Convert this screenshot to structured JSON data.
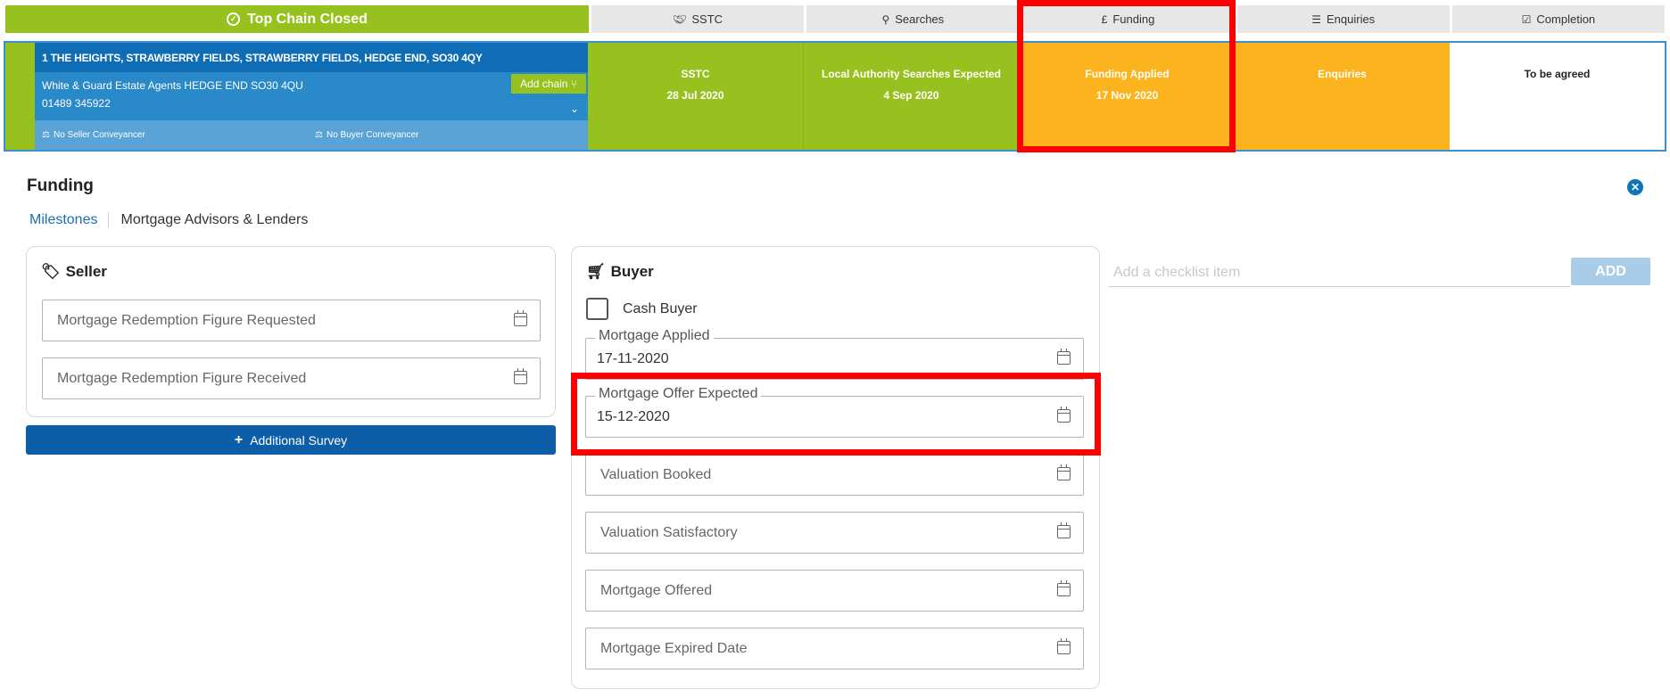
{
  "stages": {
    "chain_label": "Top Chain Closed",
    "tabs": [
      {
        "label": "SSTC",
        "icon": "handshake-icon"
      },
      {
        "label": "Searches",
        "icon": "search-icon"
      },
      {
        "label": "Funding",
        "icon": "pound-icon"
      },
      {
        "label": "Enquiries",
        "icon": "list-icon"
      },
      {
        "label": "Completion",
        "icon": "checkbox-icon"
      }
    ]
  },
  "property": {
    "address": "1 THE HEIGHTS, STRAWBERRY FIELDS, STRAWBERRY FIELDS, HEDGE END, SO30 4QY",
    "agent": "White & Guard Estate Agents HEDGE END SO30 4QU",
    "phone": "01489 345922",
    "add_chain_label": "Add chain",
    "seller_conveyancer": "No Seller Conveyancer",
    "buyer_conveyancer": "No Buyer Conveyancer"
  },
  "milestones": [
    {
      "title": "SSTC",
      "date": "28 Jul 2020",
      "status": "green"
    },
    {
      "title": "Local Authority Searches Expected",
      "date": "4 Sep 2020",
      "status": "green"
    },
    {
      "title": "Funding Applied",
      "date": "17 Nov 2020",
      "status": "orange"
    },
    {
      "title": "Enquiries",
      "date": "",
      "status": "orange"
    },
    {
      "title": "To be agreed",
      "date": "",
      "status": "white"
    }
  ],
  "funding": {
    "title": "Funding",
    "tabs": [
      "Milestones",
      "Mortgage Advisors & Lenders"
    ],
    "seller": {
      "title": "Seller",
      "fields": [
        {
          "placeholder": "Mortgage Redemption Figure Requested"
        },
        {
          "placeholder": "Mortgage Redemption Figure Received"
        }
      ],
      "survey_button": "Additional Survey"
    },
    "buyer": {
      "title": "Buyer",
      "cash_buyer_label": "Cash Buyer",
      "cash_buyer_checked": false,
      "fields": [
        {
          "label": "Mortgage Applied",
          "value": "17-11-2020"
        },
        {
          "label": "Mortgage Offer Expected",
          "value": "15-12-2020"
        },
        {
          "placeholder": "Valuation Booked"
        },
        {
          "placeholder": "Valuation Satisfactory"
        },
        {
          "placeholder": "Mortgage Offered"
        },
        {
          "placeholder": "Mortgage Expired Date"
        }
      ]
    },
    "checklist": {
      "placeholder": "Add a checklist item",
      "add_label": "ADD"
    }
  },
  "colors": {
    "green": "#97c11f",
    "orange": "#fbb31e",
    "blue": "#0f6db5",
    "highlight": "#ff0000"
  }
}
